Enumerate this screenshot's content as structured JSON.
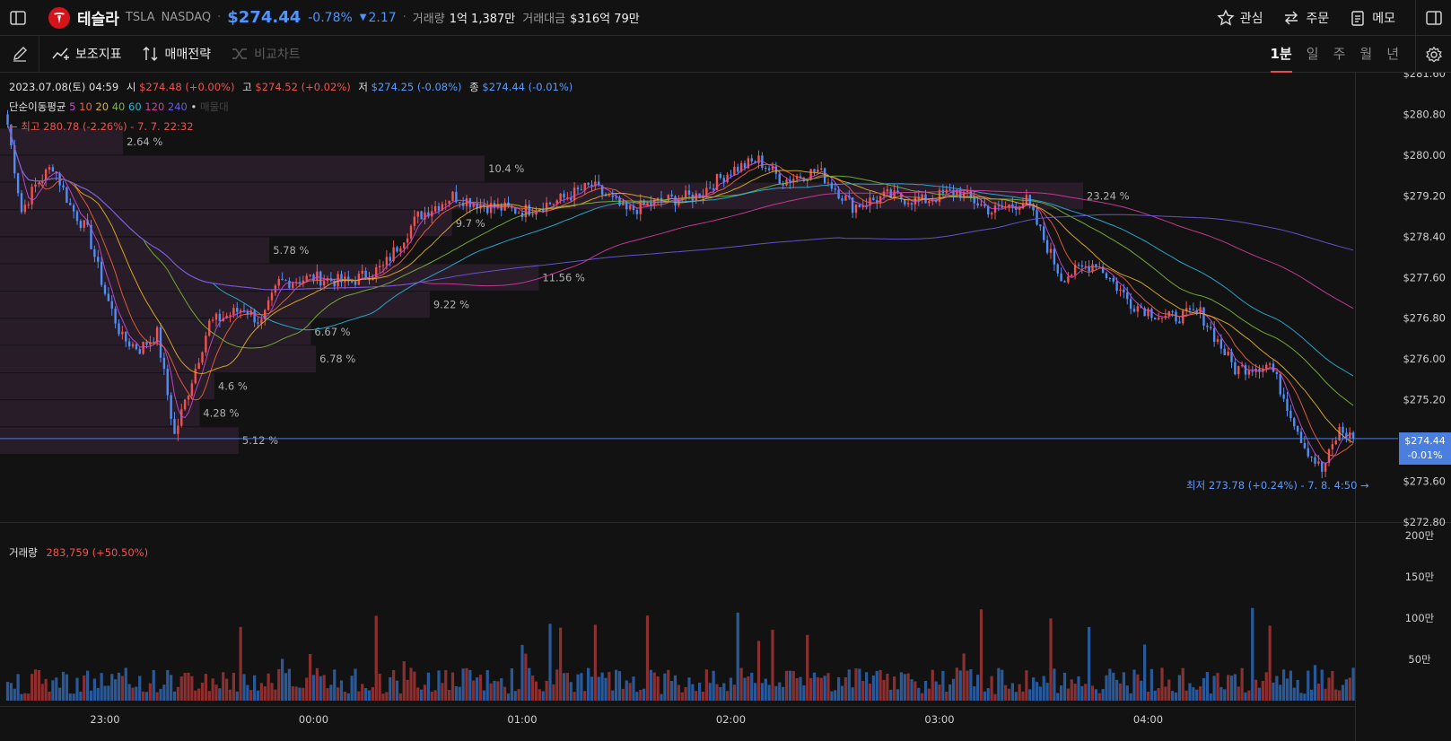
{
  "header": {
    "stock_name": "테슬라",
    "ticker": "TSLA",
    "exchange": "NASDAQ",
    "price": "$274.44",
    "change_pct": "-0.78%",
    "change_abs": "2.17",
    "volume_label": "거래량",
    "volume_value": "1억 1,387만",
    "turnover_label": "거래대금",
    "turnover_value": "$316억 79만",
    "watch_label": "관심",
    "order_label": "주문",
    "memo_label": "메모",
    "icons": [
      "sidebar-toggle-icon",
      "tesla-logo",
      "star-icon",
      "swap-arrows-icon",
      "memo-icon",
      "panel-toggle-icon"
    ]
  },
  "toolbar": {
    "indicators_label": "보조지표",
    "strategy_label": "매매전략",
    "compare_label": "비교차트",
    "intervals": [
      "1분",
      "일",
      "주",
      "월",
      "년"
    ],
    "active_interval": "1분",
    "icons": [
      "pencil-icon",
      "indicator-icon",
      "strategy-icon",
      "compare-icon",
      "settings-icon"
    ]
  },
  "ohlc": {
    "date": "2023.07.08(토) 04:59",
    "open_label": "시",
    "open": "$274.48 (+0.00%)",
    "high_label": "고",
    "high": "$274.52 (+0.02%)",
    "low_label": "저",
    "low": "$274.25 (-0.08%)",
    "close_label": "종",
    "close": "$274.44 (-0.01%)"
  },
  "ma": {
    "label": "단순이동평균",
    "periods": [
      {
        "text": "5",
        "color": "#c94bd6"
      },
      {
        "text": "10",
        "color": "#f0623c"
      },
      {
        "text": "20",
        "color": "#e5b128"
      },
      {
        "text": "40",
        "color": "#79b83a"
      },
      {
        "text": "60",
        "color": "#2ab4d8"
      },
      {
        "text": "120",
        "color": "#d63ca0"
      },
      {
        "text": "240",
        "color": "#6a5be0"
      }
    ],
    "extra": "매물대"
  },
  "annotations": {
    "high_marker": "← 최고 280.78 (-2.26%) - 7. 7. 22:32",
    "low_marker": "최저 273.78 (+0.24%) - 7. 8. 4:50 →"
  },
  "current_tag": {
    "price": "$274.44",
    "pct": "-0.01%"
  },
  "volume_panel": {
    "label": "거래량",
    "value": "283,759 (+50.50%)"
  },
  "colors": {
    "up": "#ef5350",
    "down": "#4f8ef7",
    "background": "#121212",
    "profile": "#2b1f2c"
  },
  "chart_data": {
    "type": "candlestick",
    "interval": "1분",
    "price_axis_ticks": [
      "$281.60",
      "$280.80",
      "$280.00",
      "$279.20",
      "$278.40",
      "$277.60",
      "$276.80",
      "$276.00",
      "$275.20",
      "$274.44",
      "$273.60",
      "$272.80"
    ],
    "ylim": [
      272.8,
      281.6
    ],
    "time_axis_ticks": [
      "23:00",
      "00:00",
      "01:00",
      "02:00",
      "03:00",
      "04:00"
    ],
    "volume_axis_ticks": [
      "200만",
      "150만",
      "100만",
      "50만"
    ],
    "volume_ylim": [
      0,
      2000000
    ],
    "price_levels": [
      274.44
    ],
    "volume_profile": [
      {
        "price_low": 280.0,
        "price_high": 280.53,
        "pct": "2.64 %"
      },
      {
        "price_low": 279.47,
        "price_high": 280.0,
        "pct": "10.4 %"
      },
      {
        "price_low": 278.93,
        "price_high": 279.47,
        "pct": "23.24 %"
      },
      {
        "price_low": 278.4,
        "price_high": 278.93,
        "pct": "9.7 %"
      },
      {
        "price_low": 277.87,
        "price_high": 278.4,
        "pct": "5.78 %"
      },
      {
        "price_low": 277.33,
        "price_high": 277.87,
        "pct": "11.56 %"
      },
      {
        "price_low": 276.8,
        "price_high": 277.33,
        "pct": "9.22 %"
      },
      {
        "price_low": 276.27,
        "price_high": 276.8,
        "pct": "6.67 %"
      },
      {
        "price_low": 275.73,
        "price_high": 276.27,
        "pct": "6.78 %"
      },
      {
        "price_low": 275.2,
        "price_high": 275.73,
        "pct": "4.6 %"
      },
      {
        "price_low": 274.67,
        "price_high": 275.2,
        "pct": "4.28 %"
      },
      {
        "price_low": 274.13,
        "price_high": 274.67,
        "pct": "5.12 %"
      }
    ],
    "price_path": [
      {
        "t": "22:32",
        "p": 280.6
      },
      {
        "t": "22:36",
        "p": 278.9
      },
      {
        "t": "22:40",
        "p": 279.4
      },
      {
        "t": "22:45",
        "p": 279.8
      },
      {
        "t": "22:50",
        "p": 279.0
      },
      {
        "t": "22:55",
        "p": 278.5
      },
      {
        "t": "23:00",
        "p": 277.3
      },
      {
        "t": "23:05",
        "p": 276.4
      },
      {
        "t": "23:10",
        "p": 276.2
      },
      {
        "t": "23:15",
        "p": 276.5
      },
      {
        "t": "23:20",
        "p": 274.5
      },
      {
        "t": "23:25",
        "p": 275.6
      },
      {
        "t": "23:30",
        "p": 276.7
      },
      {
        "t": "23:40",
        "p": 277.0
      },
      {
        "t": "23:45",
        "p": 276.7
      },
      {
        "t": "23:50",
        "p": 277.5
      },
      {
        "t": "00:00",
        "p": 277.6
      },
      {
        "t": "00:10",
        "p": 277.5
      },
      {
        "t": "00:20",
        "p": 277.8
      },
      {
        "t": "00:30",
        "p": 278.8
      },
      {
        "t": "00:40",
        "p": 279.2
      },
      {
        "t": "00:50",
        "p": 279.0
      },
      {
        "t": "01:00",
        "p": 278.9
      },
      {
        "t": "01:10",
        "p": 279.1
      },
      {
        "t": "01:20",
        "p": 279.4
      },
      {
        "t": "01:30",
        "p": 278.9
      },
      {
        "t": "01:40",
        "p": 279.1
      },
      {
        "t": "01:50",
        "p": 279.2
      },
      {
        "t": "02:00",
        "p": 279.7
      },
      {
        "t": "02:08",
        "p": 279.9
      },
      {
        "t": "02:15",
        "p": 279.5
      },
      {
        "t": "02:25",
        "p": 279.7
      },
      {
        "t": "02:35",
        "p": 279.0
      },
      {
        "t": "02:45",
        "p": 279.2
      },
      {
        "t": "02:55",
        "p": 279.1
      },
      {
        "t": "03:05",
        "p": 279.3
      },
      {
        "t": "03:15",
        "p": 278.9
      },
      {
        "t": "03:25",
        "p": 279.1
      },
      {
        "t": "03:35",
        "p": 277.6
      },
      {
        "t": "03:45",
        "p": 277.9
      },
      {
        "t": "03:55",
        "p": 277.1
      },
      {
        "t": "04:05",
        "p": 276.8
      },
      {
        "t": "04:15",
        "p": 276.9
      },
      {
        "t": "04:25",
        "p": 275.8
      },
      {
        "t": "04:35",
        "p": 275.9
      },
      {
        "t": "04:45",
        "p": 274.3
      },
      {
        "t": "04:50",
        "p": 273.8
      },
      {
        "t": "04:55",
        "p": 274.6
      },
      {
        "t": "04:59",
        "p": 274.44
      }
    ],
    "high": {
      "price": 280.78,
      "time": "7. 7. 22:32"
    },
    "low": {
      "price": 273.78,
      "time": "7. 8. 4:50"
    }
  }
}
